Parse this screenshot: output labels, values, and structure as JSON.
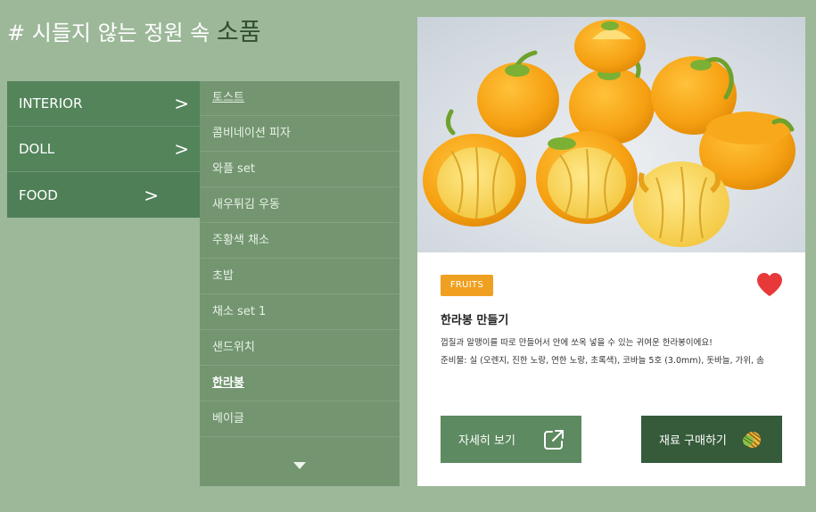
{
  "header": {
    "title_prefix": "# 시들지 않는 정원 속 ",
    "title_accent": "소품"
  },
  "categories": [
    {
      "label": "INTERIOR",
      "arrow": ">"
    },
    {
      "label": "DOLL",
      "arrow": ">"
    },
    {
      "label": "FOOD",
      "arrow": ">"
    }
  ],
  "submenu": {
    "items": [
      "토스트",
      "콤비네이션 피자",
      "와플 set",
      "새우튀김 우동",
      "주황색 채소",
      "초밥",
      "채소 set 1",
      "샌드위치",
      "한라봉",
      "베이글"
    ],
    "active_index": 8
  },
  "product": {
    "tag": "FRUITS",
    "title": "한라봉 만들기",
    "description": [
      "껍질과 알맹이를 따로 만들어서 안에 쏘옥 넣을 수 있는 귀여운 한라봉이에요!",
      "준비물: 실 (오렌지, 진한 노랑, 연한 노랑, 초록색), 코바늘 5호 (3.0mm), 돗바늘, 가위, 솜"
    ],
    "detail_button": "자세히 보기",
    "buy_button": "재료 구매하기"
  },
  "icons": {
    "category_arrow": "chevron-right-icon",
    "more": "caret-down-icon",
    "favorite": "heart-icon",
    "detail": "external-link-icon",
    "buy": "yarn-ball-icon"
  },
  "colors": {
    "background": "#9cb899",
    "category": "#53845a",
    "submenu": "#739670",
    "badge": "#f0a020",
    "heart": "#e8393a",
    "button_primary": "#5d8a60",
    "button_dark": "#355b3b"
  }
}
